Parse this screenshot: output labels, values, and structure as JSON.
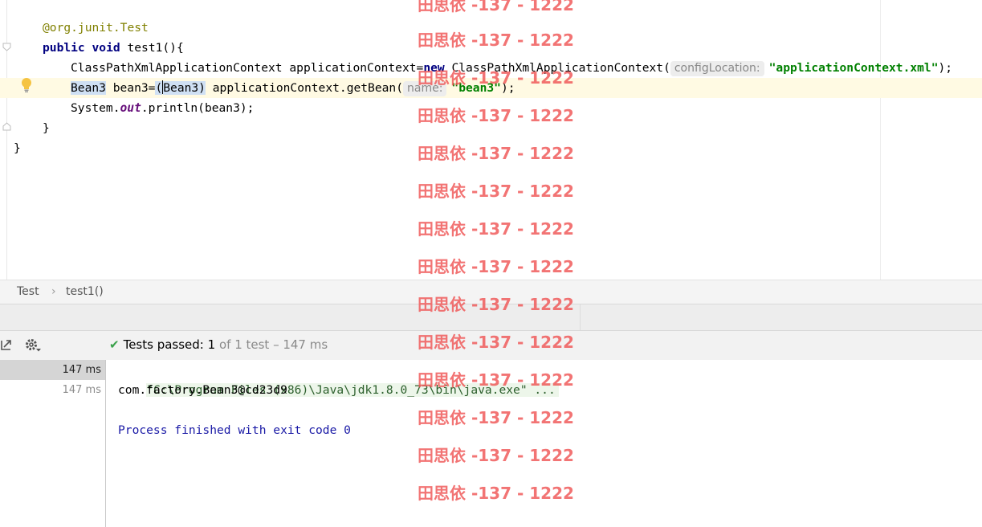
{
  "editor": {
    "lines": [
      {
        "annotation": "@org.junit.",
        "annotation_class": "Test"
      },
      {
        "kw1": "public",
        "kw2": "void",
        "method": "test1(){"
      },
      {
        "type": "ClassPathXmlApplicationContext",
        "var": "applicationContext=",
        "kw_new": "new",
        "ctor": "ClassPathXmlApplicationContext(",
        "hint": "configLocation:",
        "arg": "\"applicationContext.xml\"",
        "end": ");"
      },
      {
        "type": "Bean3",
        "var": "bean3=",
        "cast_open": "(",
        "cast_type": "Bean3)",
        "call": "applicationContext.getBean(",
        "hint": "name:",
        "arg": "\"bean3\"",
        "end": ");"
      },
      {
        "obj": "System.",
        "field": "out",
        "call": ".println(bean3);"
      },
      {
        "text": "}"
      },
      {
        "text": "}"
      }
    ]
  },
  "breadcrumb": {
    "class_name": "Test",
    "separator": "›",
    "method": "test1()"
  },
  "run_panel": {
    "status_check": "✔",
    "status_label": "Tests passed:",
    "status_count": "1",
    "status_rest": "of 1 test – 147 ms",
    "tree": [
      {
        "time": "147 ms",
        "selected": true
      },
      {
        "time": "147 ms",
        "selected": false
      }
    ],
    "console": {
      "command": "\"C:\\Program Files (x86)\\Java\\jdk1.8.0_73\\bin\\java.exe\" ...",
      "output": "com.factory.Bean3@cd23d9",
      "exit": "Process finished with exit code 0"
    }
  },
  "watermark": {
    "text": "田思依 -137 - 1222"
  },
  "colors": {
    "keyword": "#000080",
    "string": "#008000",
    "annotation": "#808000",
    "static_field": "#660e7a",
    "success": "#3aa14a",
    "watermark": "#ef5555"
  }
}
